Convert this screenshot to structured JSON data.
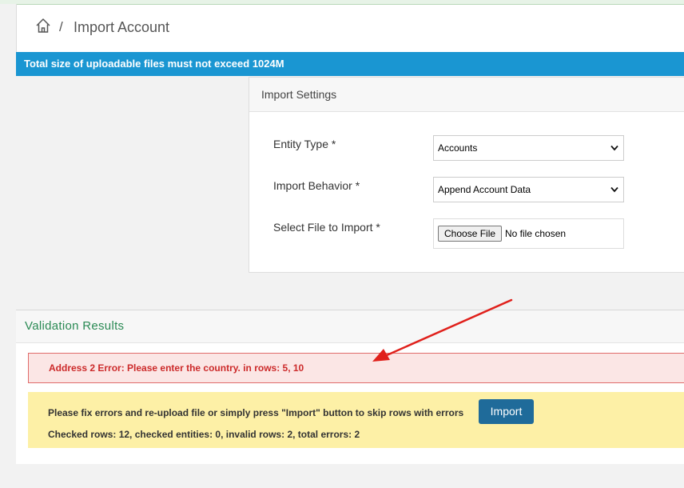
{
  "breadcrumb": {
    "separator": "/",
    "title": "Import Account"
  },
  "notice": {
    "text": "Total size of uploadable files must not exceed 1024M"
  },
  "settings": {
    "title": "Import Settings",
    "entity_type": {
      "label": "Entity Type *",
      "value": "Accounts"
    },
    "import_behavior": {
      "label": "Import Behavior *",
      "value": "Append Account Data"
    },
    "file": {
      "label": "Select File to Import *",
      "button": "Choose File",
      "status": "No file chosen"
    }
  },
  "validation": {
    "title": "Validation Results",
    "error": "Address 2 Error: Please enter the country. in rows: 5, 10",
    "warning": "Please fix errors and re-upload file or simply press \"Import\" button to skip rows with errors",
    "import_button": "Import",
    "stats": "Checked rows: 12, checked entities: 0, invalid rows: 2, total errors: 2"
  },
  "colors": {
    "notice_bg": "#1a96d2",
    "annotation_arrow": "#e0201b",
    "import_button": "#1f6b9a",
    "error_text": "#cc2a2a"
  },
  "icons": {
    "home": "home-icon",
    "select_arrow": "chevron-down-icon",
    "annotation": "red-arrow-annotation"
  }
}
